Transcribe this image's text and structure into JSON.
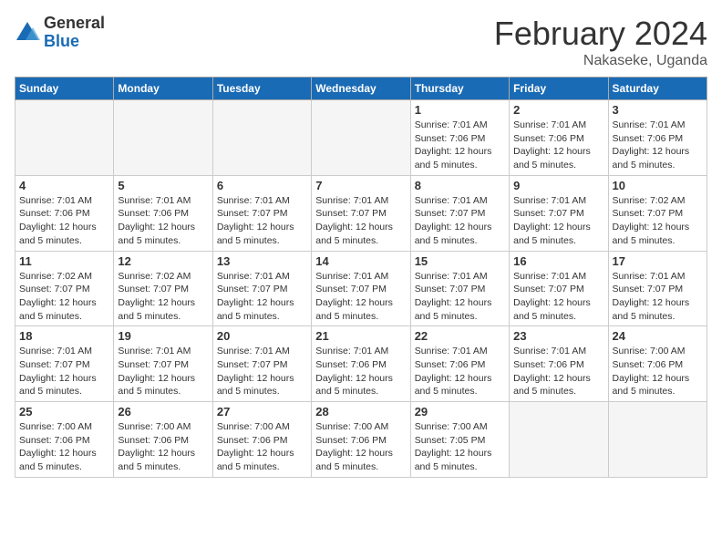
{
  "header": {
    "logo_general": "General",
    "logo_blue": "Blue",
    "month_title": "February 2024",
    "location": "Nakaseke, Uganda"
  },
  "days_of_week": [
    "Sunday",
    "Monday",
    "Tuesday",
    "Wednesday",
    "Thursday",
    "Friday",
    "Saturday"
  ],
  "weeks": [
    [
      {
        "day": "",
        "info": ""
      },
      {
        "day": "",
        "info": ""
      },
      {
        "day": "",
        "info": ""
      },
      {
        "day": "",
        "info": ""
      },
      {
        "day": "1",
        "info": "Sunrise: 7:01 AM\nSunset: 7:06 PM\nDaylight: 12 hours\nand 5 minutes."
      },
      {
        "day": "2",
        "info": "Sunrise: 7:01 AM\nSunset: 7:06 PM\nDaylight: 12 hours\nand 5 minutes."
      },
      {
        "day": "3",
        "info": "Sunrise: 7:01 AM\nSunset: 7:06 PM\nDaylight: 12 hours\nand 5 minutes."
      }
    ],
    [
      {
        "day": "4",
        "info": "Sunrise: 7:01 AM\nSunset: 7:06 PM\nDaylight: 12 hours\nand 5 minutes."
      },
      {
        "day": "5",
        "info": "Sunrise: 7:01 AM\nSunset: 7:06 PM\nDaylight: 12 hours\nand 5 minutes."
      },
      {
        "day": "6",
        "info": "Sunrise: 7:01 AM\nSunset: 7:07 PM\nDaylight: 12 hours\nand 5 minutes."
      },
      {
        "day": "7",
        "info": "Sunrise: 7:01 AM\nSunset: 7:07 PM\nDaylight: 12 hours\nand 5 minutes."
      },
      {
        "day": "8",
        "info": "Sunrise: 7:01 AM\nSunset: 7:07 PM\nDaylight: 12 hours\nand 5 minutes."
      },
      {
        "day": "9",
        "info": "Sunrise: 7:01 AM\nSunset: 7:07 PM\nDaylight: 12 hours\nand 5 minutes."
      },
      {
        "day": "10",
        "info": "Sunrise: 7:02 AM\nSunset: 7:07 PM\nDaylight: 12 hours\nand 5 minutes."
      }
    ],
    [
      {
        "day": "11",
        "info": "Sunrise: 7:02 AM\nSunset: 7:07 PM\nDaylight: 12 hours\nand 5 minutes."
      },
      {
        "day": "12",
        "info": "Sunrise: 7:02 AM\nSunset: 7:07 PM\nDaylight: 12 hours\nand 5 minutes."
      },
      {
        "day": "13",
        "info": "Sunrise: 7:01 AM\nSunset: 7:07 PM\nDaylight: 12 hours\nand 5 minutes."
      },
      {
        "day": "14",
        "info": "Sunrise: 7:01 AM\nSunset: 7:07 PM\nDaylight: 12 hours\nand 5 minutes."
      },
      {
        "day": "15",
        "info": "Sunrise: 7:01 AM\nSunset: 7:07 PM\nDaylight: 12 hours\nand 5 minutes."
      },
      {
        "day": "16",
        "info": "Sunrise: 7:01 AM\nSunset: 7:07 PM\nDaylight: 12 hours\nand 5 minutes."
      },
      {
        "day": "17",
        "info": "Sunrise: 7:01 AM\nSunset: 7:07 PM\nDaylight: 12 hours\nand 5 minutes."
      }
    ],
    [
      {
        "day": "18",
        "info": "Sunrise: 7:01 AM\nSunset: 7:07 PM\nDaylight: 12 hours\nand 5 minutes."
      },
      {
        "day": "19",
        "info": "Sunrise: 7:01 AM\nSunset: 7:07 PM\nDaylight: 12 hours\nand 5 minutes."
      },
      {
        "day": "20",
        "info": "Sunrise: 7:01 AM\nSunset: 7:07 PM\nDaylight: 12 hours\nand 5 minutes."
      },
      {
        "day": "21",
        "info": "Sunrise: 7:01 AM\nSunset: 7:06 PM\nDaylight: 12 hours\nand 5 minutes."
      },
      {
        "day": "22",
        "info": "Sunrise: 7:01 AM\nSunset: 7:06 PM\nDaylight: 12 hours\nand 5 minutes."
      },
      {
        "day": "23",
        "info": "Sunrise: 7:01 AM\nSunset: 7:06 PM\nDaylight: 12 hours\nand 5 minutes."
      },
      {
        "day": "24",
        "info": "Sunrise: 7:00 AM\nSunset: 7:06 PM\nDaylight: 12 hours\nand 5 minutes."
      }
    ],
    [
      {
        "day": "25",
        "info": "Sunrise: 7:00 AM\nSunset: 7:06 PM\nDaylight: 12 hours\nand 5 minutes."
      },
      {
        "day": "26",
        "info": "Sunrise: 7:00 AM\nSunset: 7:06 PM\nDaylight: 12 hours\nand 5 minutes."
      },
      {
        "day": "27",
        "info": "Sunrise: 7:00 AM\nSunset: 7:06 PM\nDaylight: 12 hours\nand 5 minutes."
      },
      {
        "day": "28",
        "info": "Sunrise: 7:00 AM\nSunset: 7:06 PM\nDaylight: 12 hours\nand 5 minutes."
      },
      {
        "day": "29",
        "info": "Sunrise: 7:00 AM\nSunset: 7:05 PM\nDaylight: 12 hours\nand 5 minutes."
      },
      {
        "day": "",
        "info": ""
      },
      {
        "day": "",
        "info": ""
      }
    ]
  ]
}
